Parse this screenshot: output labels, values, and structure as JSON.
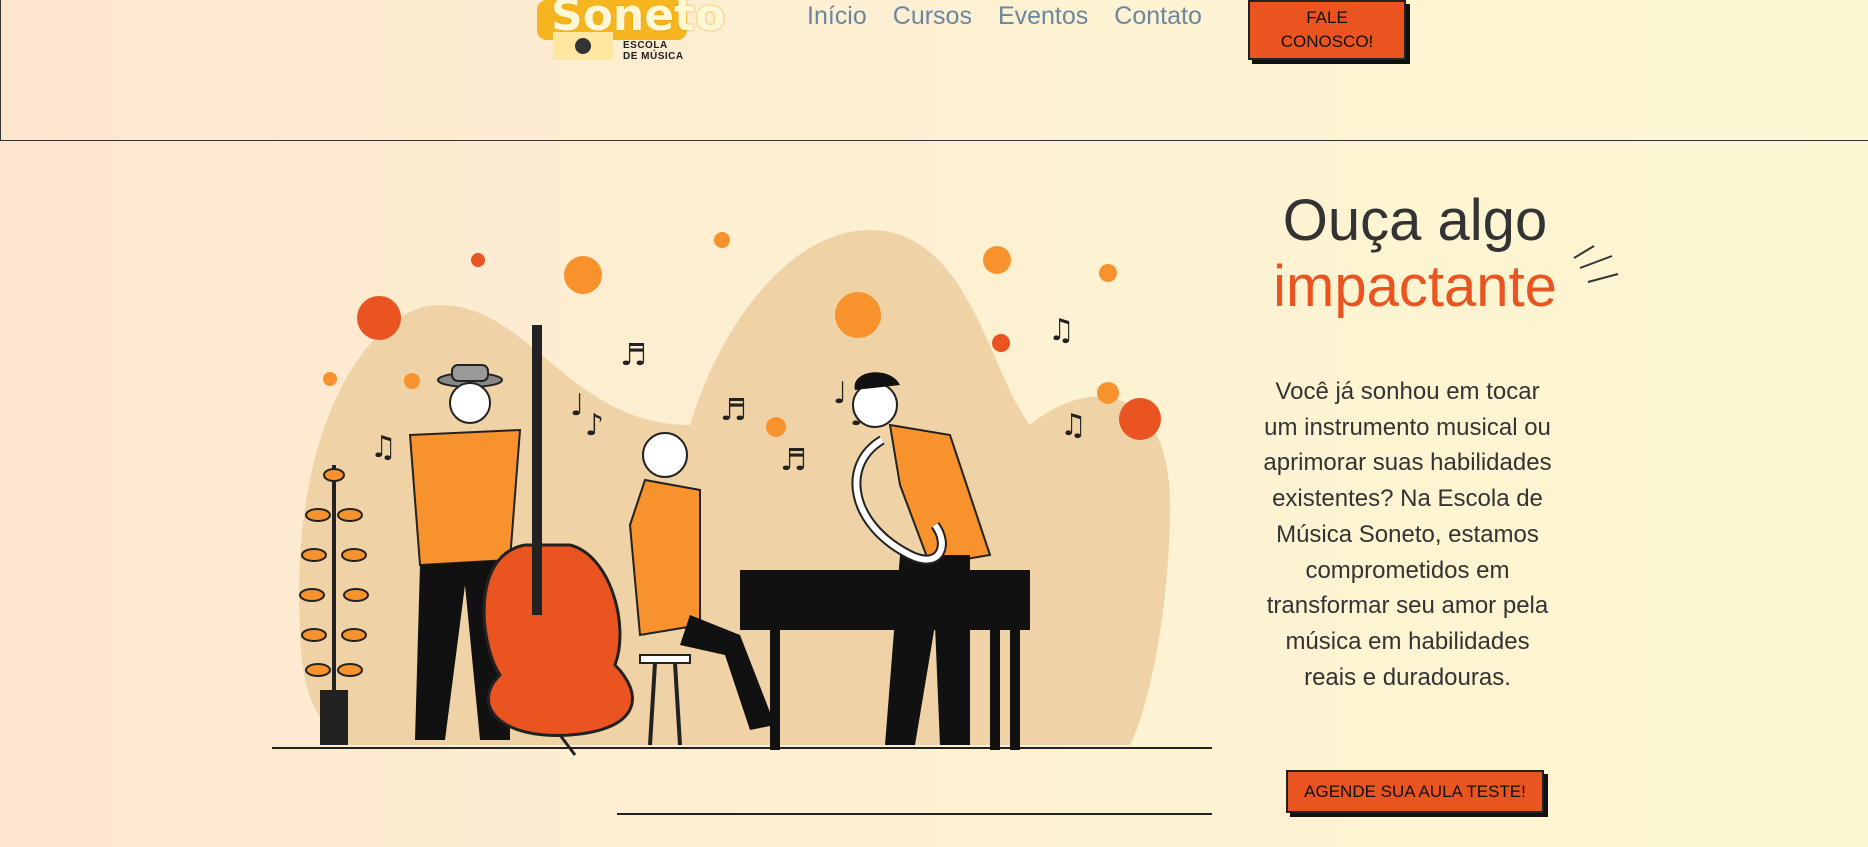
{
  "brand": {
    "name": "Soneto",
    "tagline_line1": "ESCOLA",
    "tagline_line2": "DE MÚSICA"
  },
  "nav": {
    "items": [
      "Início",
      "Cursos",
      "Eventos",
      "Contato"
    ]
  },
  "header_cta": "FALE\nCONOSCO!",
  "hero": {
    "title_line1": "Ouça algo",
    "title_line2": "impactante",
    "body": "Você já sonhou em tocar um instrumento musical ou aprimorar suas habilidades existentes? Na Escola de Música Soneto, estamos comprometidos em transformar seu amor pela música em habilidades reais e duradouras.",
    "cta": "AGENDE SUA AULA TESTE!"
  },
  "colors": {
    "accent": "#ea5420",
    "orange": "#f7922d",
    "blob": "#efd3a6",
    "nav_text": "#6c86a0"
  }
}
